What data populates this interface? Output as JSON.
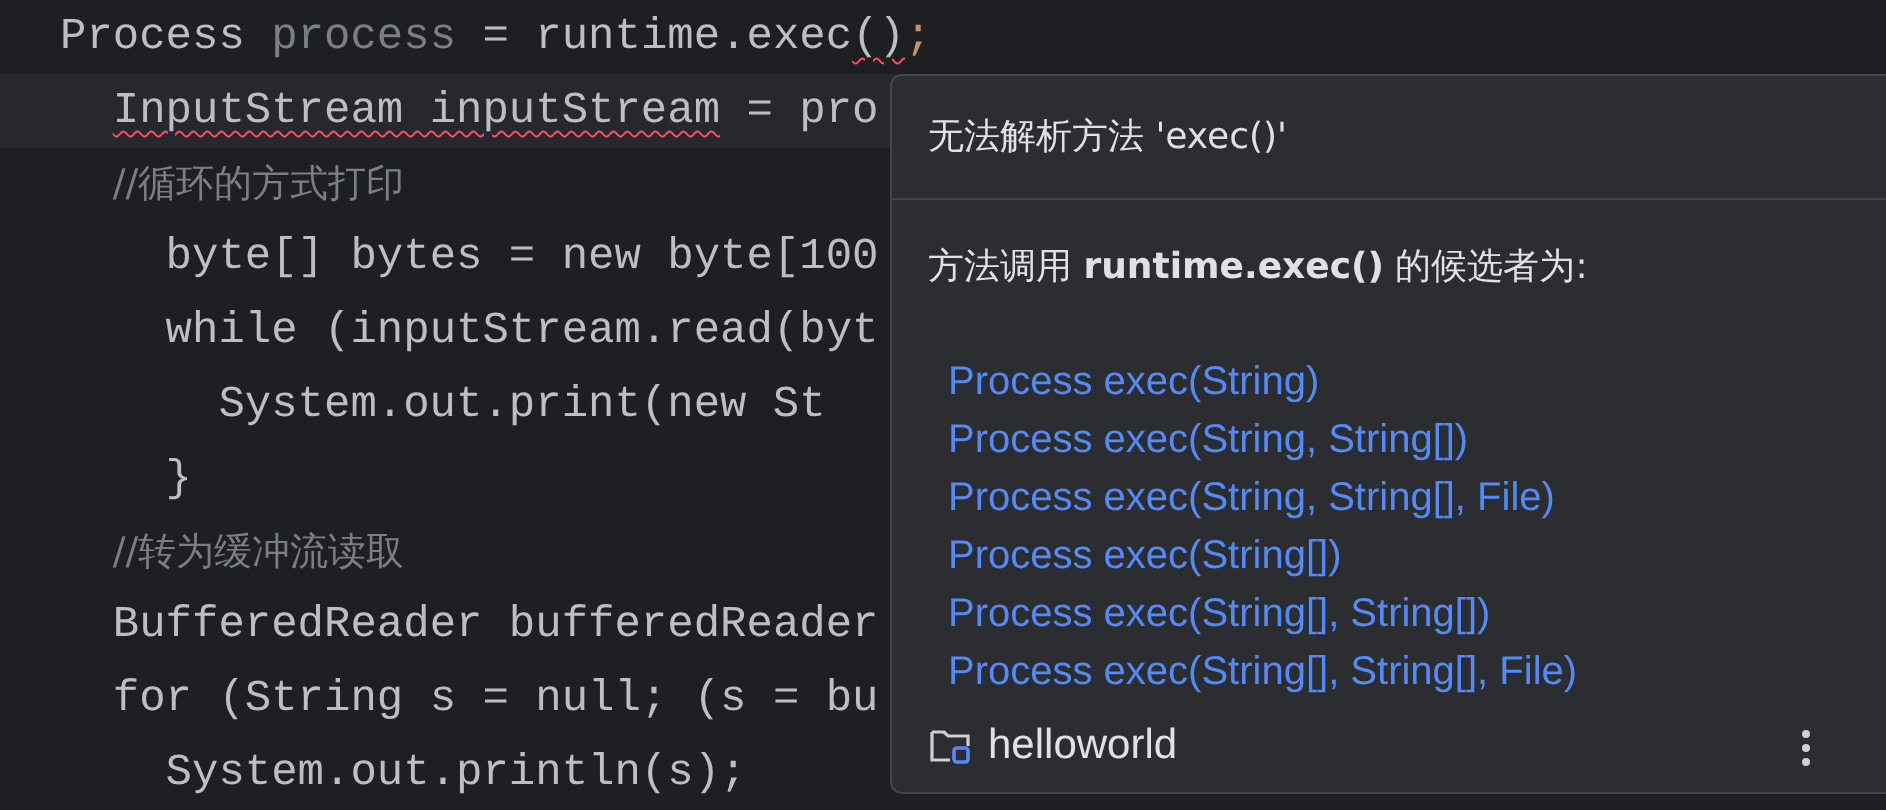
{
  "editor": {
    "lines": [
      {
        "current": false,
        "segments": [
          {
            "kind": "plain",
            "text": "Process "
          },
          {
            "kind": "unused",
            "text": "process"
          },
          {
            "kind": "plain",
            "text": " = runtime.exec"
          },
          {
            "kind": "error",
            "text": "()"
          },
          {
            "kind": "semicolon",
            "text": ";"
          }
        ],
        "children": [
          {
            "current": true,
            "segments": [
              {
                "kind": "error",
                "text": "InputStream inputStream"
              },
              {
                "kind": "plain",
                "text": " = pro"
              }
            ]
          },
          {
            "current": false,
            "segments": [
              {
                "kind": "comment",
                "text": "//循环的方式打印"
              }
            ],
            "children": [
              {
                "current": false,
                "segments": [
                  {
                    "kind": "plain",
                    "text": "byte[] bytes = new byte[100"
                  }
                ]
              },
              {
                "current": false,
                "segments": [
                  {
                    "kind": "plain",
                    "text": "while (inputStream.read(byt"
                  }
                ],
                "children": [
                  {
                    "current": false,
                    "segments": [
                      {
                        "kind": "plain",
                        "text": "System.out.print(new St"
                      }
                    ]
                  }
                ]
              },
              {
                "current": false,
                "segments": [
                  {
                    "kind": "plain",
                    "text": "}"
                  }
                ]
              }
            ]
          },
          {
            "current": false,
            "segments": [
              {
                "kind": "comment",
                "text": "//转为缓冲流读取"
              }
            ]
          },
          {
            "current": false,
            "segments": [
              {
                "kind": "plain",
                "text": "BufferedReader bufferedReader"
              }
            ]
          },
          {
            "current": false,
            "segments": [
              {
                "kind": "plain",
                "text": "for (String s = null; (s = bu"
              }
            ],
            "children": [
              {
                "current": false,
                "segments": [
                  {
                    "kind": "plain",
                    "text": "System.out.println(s);"
                  }
                ]
              }
            ]
          }
        ]
      }
    ]
  },
  "popup": {
    "title": "无法解析方法 'exec()'",
    "message": "方法调用 **runtime.exec()** 的候选者为:",
    "candidates": [
      "Process exec(String)",
      "Process exec(String, String[])",
      "Process exec(String, String[], File)",
      "Process exec(String[])",
      "Process exec(String[], String[])",
      "Process exec(String[], String[], File)"
    ],
    "footer": {
      "project": "helloworld"
    }
  }
}
